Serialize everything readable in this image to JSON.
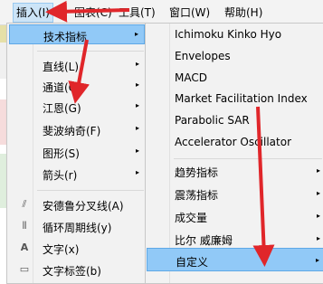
{
  "menubar": {
    "items": [
      {
        "label": "插入(I)"
      },
      {
        "label": "图表(C)"
      },
      {
        "label": "工具(T)"
      },
      {
        "label": "窗口(W)"
      },
      {
        "label": "帮助(H)"
      }
    ]
  },
  "insert_menu": {
    "items": [
      {
        "label": "技术指标",
        "submenu": true,
        "highlighted": true
      },
      {
        "label": "直线(L)",
        "submenu": true
      },
      {
        "label": "通道(C)",
        "submenu": true
      },
      {
        "label": "江恩(G)",
        "submenu": true
      },
      {
        "label": "斐波纳奇(F)",
        "submenu": true
      },
      {
        "label": "图形(S)",
        "submenu": true
      },
      {
        "label": "箭头(r)",
        "submenu": true
      },
      {
        "label": "安德鲁分叉线(A)",
        "icon": "pitchfork-icon"
      },
      {
        "label": "循环周期线(y)",
        "icon": "cycle-lines-icon"
      },
      {
        "label": "文字(x)",
        "icon": "text-icon"
      },
      {
        "label": "文字标签(b)",
        "icon": "text-label-icon"
      }
    ]
  },
  "indicators_submenu": {
    "items": [
      {
        "label": "Ichimoku Kinko Hyo"
      },
      {
        "label": "Envelopes"
      },
      {
        "label": "MACD"
      },
      {
        "label": "Market Facilitation Index"
      },
      {
        "label": "Parabolic SAR"
      },
      {
        "label": "Accelerator Oscillator"
      }
    ],
    "groups": [
      {
        "label": "趋势指标",
        "submenu": true
      },
      {
        "label": "震荡指标",
        "submenu": true
      },
      {
        "label": "成交量",
        "submenu": true
      },
      {
        "label": "比尔 威廉姆",
        "submenu": true
      },
      {
        "label": "自定义",
        "submenu": true,
        "highlighted": true
      }
    ]
  },
  "icons": {
    "pitchfork": "⫽",
    "cycle": "⦀",
    "text": "A",
    "label": "▭"
  },
  "submenu_arrow": "▸",
  "colors": {
    "highlight": "#91c9f7",
    "annotation": "#e0262a",
    "menu_bg": "#f2f2f2"
  }
}
